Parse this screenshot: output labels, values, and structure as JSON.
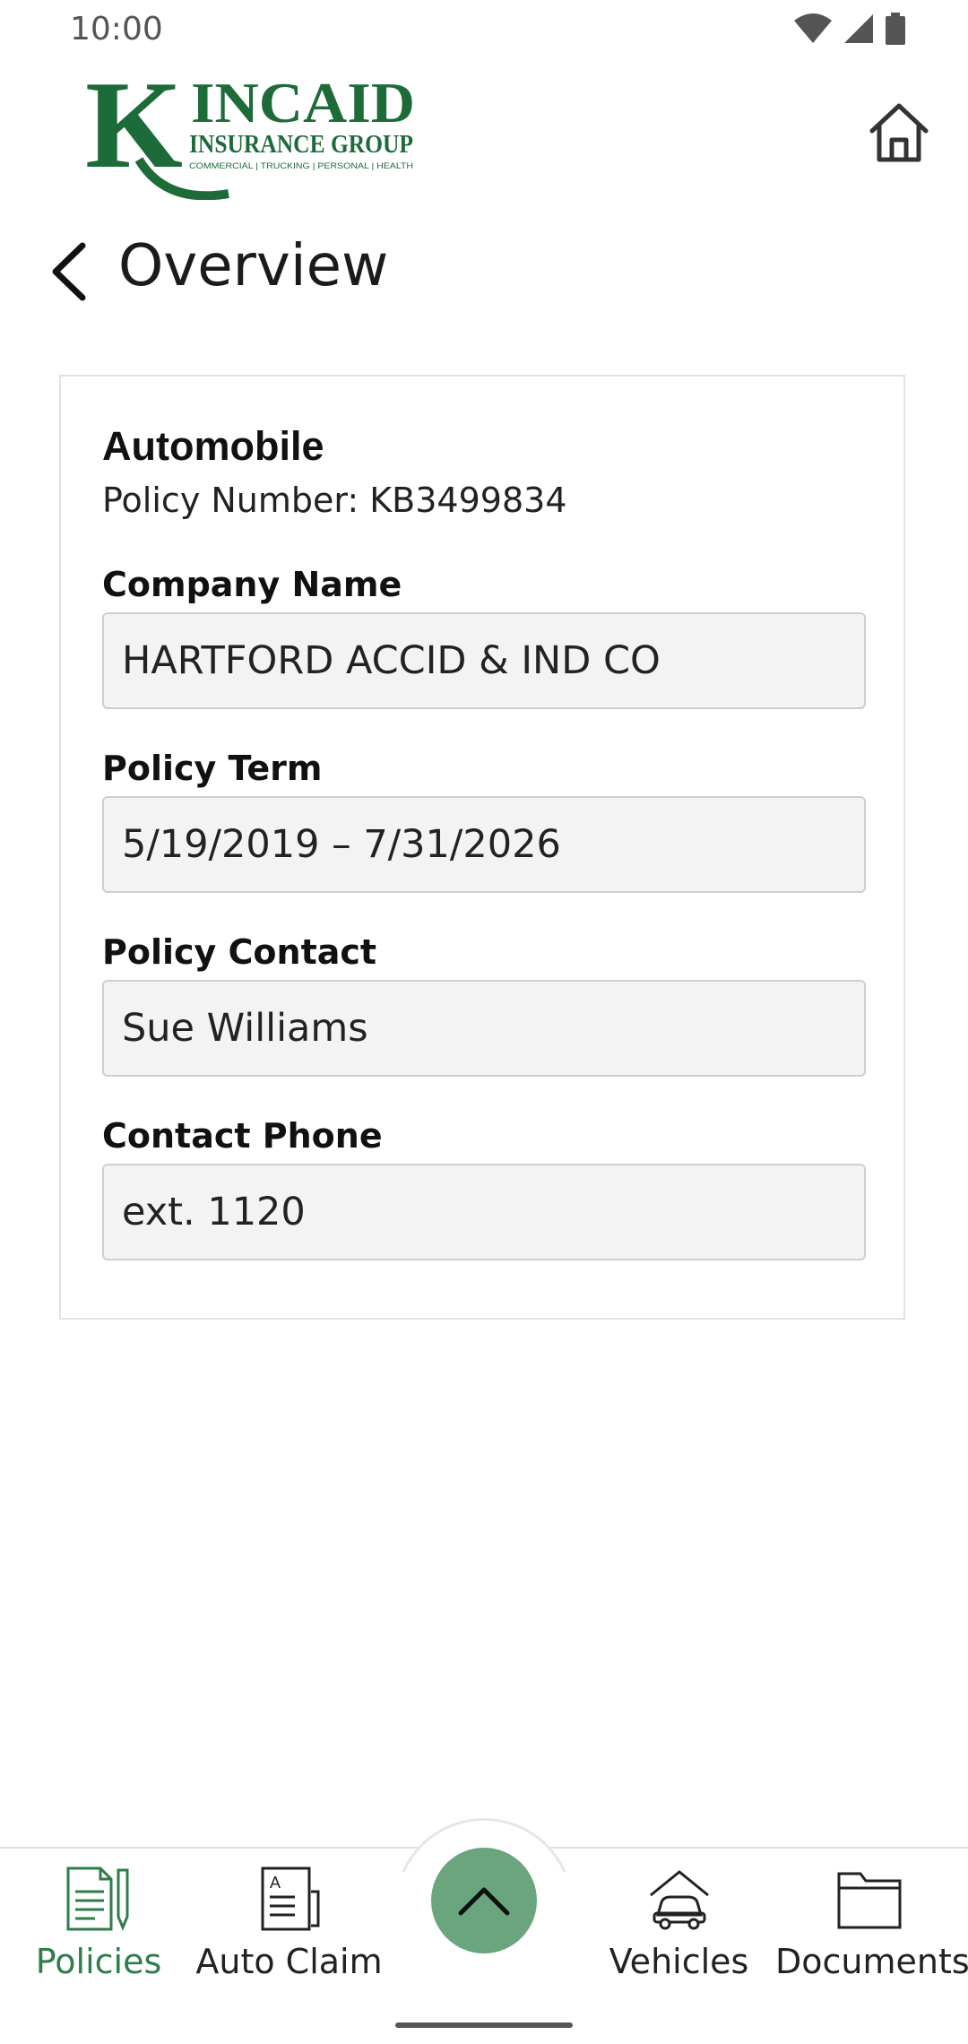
{
  "status_bar": {
    "time": "10:00"
  },
  "header": {
    "logo_letter": "K",
    "logo_name": "INCAID",
    "logo_group": "INSURANCE GROUP",
    "logo_tagline": "COMMERCIAL | TRUCKING | PERSONAL | HEALTH"
  },
  "page": {
    "title": "Overview"
  },
  "policy": {
    "type": "Automobile",
    "number_label": "Policy Number:",
    "number_value": "KB3499834",
    "fields": [
      {
        "label": "Company Name",
        "value": "HARTFORD ACCID & IND CO"
      },
      {
        "label": "Policy Term",
        "value": "5/19/2019 – 7/31/2026"
      },
      {
        "label": "Policy Contact",
        "value": "Sue Williams"
      },
      {
        "label": "Contact Phone",
        "value": "ext. 1120"
      }
    ]
  },
  "bottom_nav": {
    "items": [
      {
        "label": "Policies",
        "icon": "policies-icon",
        "active": true
      },
      {
        "label": "Auto Claim",
        "icon": "auto-claim-icon",
        "active": false
      },
      {
        "label": "Vehicles",
        "icon": "vehicles-icon",
        "active": false
      },
      {
        "label": "Documents",
        "icon": "documents-icon",
        "active": false
      }
    ],
    "fab_icon": "chevron-up-icon"
  },
  "colors": {
    "brand_green": "#1e6b3a",
    "active_green": "#2e7d4a",
    "fab_green": "#6aa57e"
  }
}
